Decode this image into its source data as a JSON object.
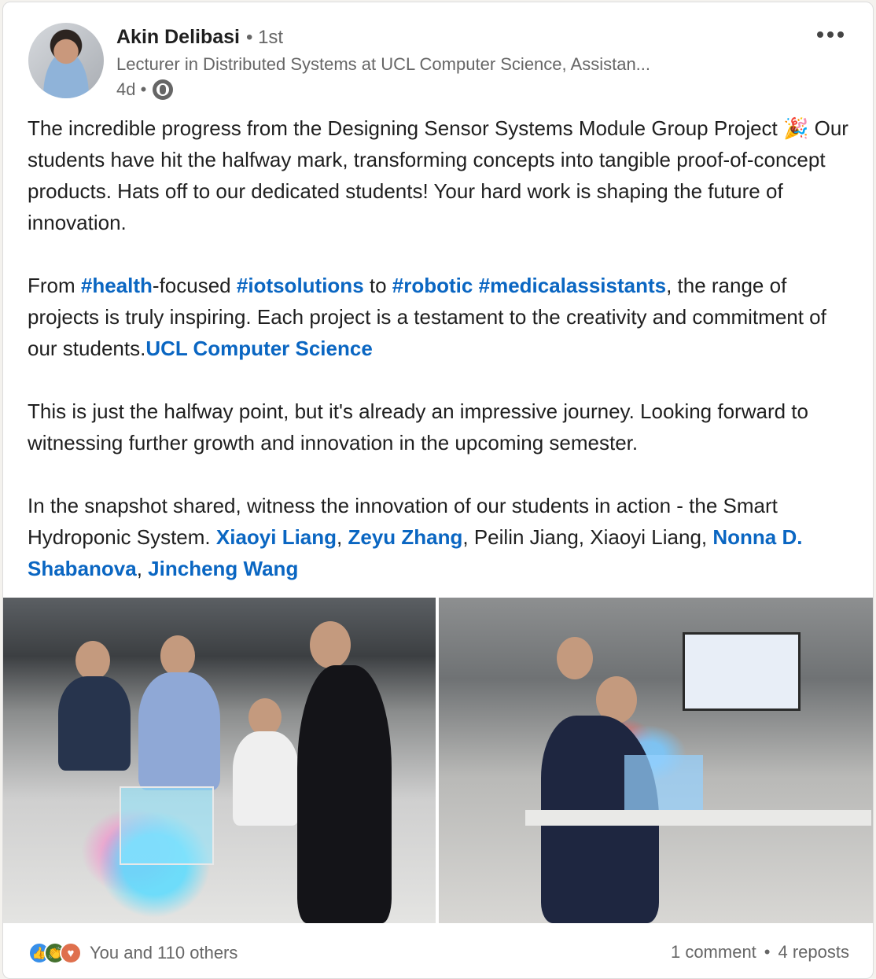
{
  "author": {
    "name": "Akin Delibasi",
    "degree": "• 1st",
    "headline": "Lecturer in Distributed Systems at UCL Computer Science, Assistan...",
    "time": "4d •"
  },
  "post": {
    "p1": {
      "text_a": "The incredible progress from the Designing Sensor Systems Module Group Project 🎉 Our students have hit the halfway mark, transforming concepts into tangible proof-of-concept products. Hats off to our dedicated students! Your hard work is shaping the future of innovation."
    },
    "p2": {
      "t1": "From ",
      "tag_health": "#health",
      "t2": "-focused ",
      "tag_iot": "#iotsolutions",
      "t3": " to ",
      "tag_robotic": "#robotic",
      "t4": " ",
      "tag_medical": "#medicalassistants",
      "t5": ", the range of projects is truly inspiring. Each project is a testament to the creativity and commitment of our students.",
      "mention_ucl": "UCL Computer Science"
    },
    "p3": {
      "text": "This is just the halfway point, but it's already an impressive journey. Looking forward to witnessing further growth and innovation in the upcoming semester."
    },
    "p4": {
      "t1": "In the snapshot shared, witness the innovation of our students in action - the Smart Hydroponic System. ",
      "m1": "Xiaoyi Liang",
      "t2": ", ",
      "m2": "Zeyu Zhang",
      "t3": ", Peilin Jiang, Xiaoyi Liang, ",
      "m3": "Nonna D. Shabanova",
      "t4": ", ",
      "m4": "Jincheng Wang"
    }
  },
  "social": {
    "reactions_text": "You and 110 others",
    "comments": "1 comment",
    "separator": "•",
    "reposts": "4 reposts"
  },
  "colors": {
    "link": "#0a66c2",
    "muted": "#666666",
    "like": "#378fe9",
    "celebrate": "#44712e",
    "love": "#df704d"
  },
  "icons": [
    "globe-icon",
    "more-icon",
    "like-icon",
    "celebrate-icon",
    "love-icon"
  ]
}
